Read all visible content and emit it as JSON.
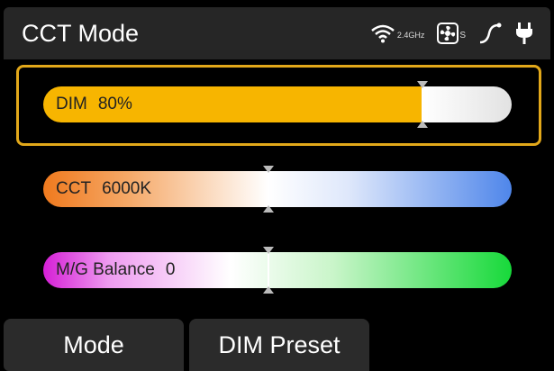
{
  "header": {
    "title": "CCT Mode",
    "wifi_band": "2.4GHz",
    "fan_subscript": "S"
  },
  "sliders": {
    "dim": {
      "name": "DIM",
      "value": "80%",
      "level": 0.81,
      "color": "#f7b500"
    },
    "cct": {
      "name": "CCT",
      "value": "6000K",
      "level": 0.48
    },
    "mg": {
      "name": "M/G Balance",
      "value": "0",
      "level": 0.48
    }
  },
  "icons": [
    "wifi-icon",
    "fan-icon",
    "curve-icon",
    "power-plug-icon"
  ],
  "tabs": {
    "mode": "Mode",
    "dim_preset": "DIM Preset"
  },
  "colors": {
    "accent": "#e2a81a",
    "header_bg": "#262626"
  }
}
